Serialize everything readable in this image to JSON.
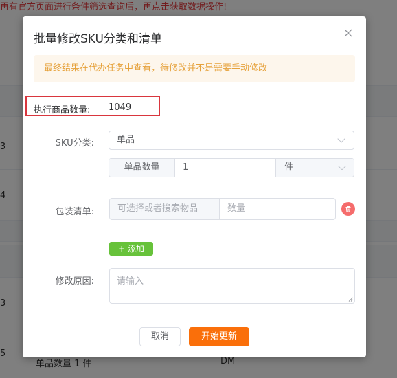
{
  "background": {
    "warning_text": "再有官方页面进行条件筛选查询后，再点击获取数据操作!",
    "row_numbers": [
      "3",
      "4",
      "3",
      "5"
    ],
    "footer_left": "单品数量 1 件",
    "footer_right": "DM"
  },
  "dialog": {
    "title": "批量修改SKU分类和清单",
    "notice": "最终结果在代办任务中查看，待修改并不是需要手动修改",
    "count_label": "执行商品数量:",
    "count_value": "1049",
    "sku_label": "SKU分类:",
    "sku_value": "单品",
    "qty_prefix": "单品数量",
    "qty_value": "1",
    "qty_unit": "件",
    "pack_label": "包装清单:",
    "pack_select_placeholder": "可选择或者搜索物品",
    "pack_qty_placeholder": "数量",
    "add_label": "+ 添加",
    "reason_label": "修改原因:",
    "reason_placeholder": "请输入",
    "cancel_label": "取消",
    "submit_label": "开始更新"
  },
  "colors": {
    "primary": "#fa6f0a",
    "success": "#67c23a",
    "danger": "#f56c6c",
    "notice_text": "#e6a23c",
    "highlight_border": "#d9363e"
  },
  "icons": {
    "close": "close-icon",
    "chevron": "chevron-down-icon",
    "delete": "trash-icon",
    "plus": "plus-icon"
  }
}
